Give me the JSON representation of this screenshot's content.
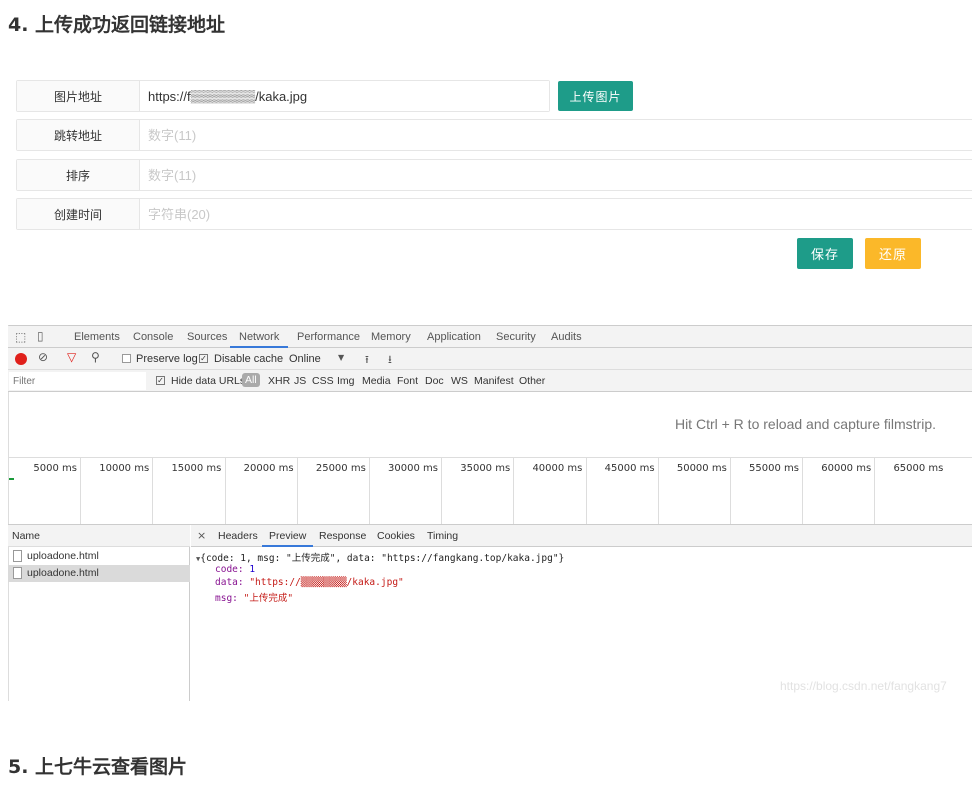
{
  "headings": {
    "h4": "4. 上传成功返回链接地址",
    "h5": "5. 上七牛云查看图片"
  },
  "form": {
    "rows": [
      {
        "label": "图片地址",
        "value": "https://f▒▒▒▒▒▒▒/kaka.jpg",
        "placeholder": ""
      },
      {
        "label": "跳转地址",
        "value": "",
        "placeholder": "数字(11)"
      },
      {
        "label": "排序",
        "value": "",
        "placeholder": "数字(11)"
      },
      {
        "label": "创建时间",
        "value": "",
        "placeholder": "字符串(20)"
      }
    ],
    "upload_label": "上传图片",
    "save_label": "保存",
    "restore_label": "还原",
    "colors": {
      "primary": "#1e9c89",
      "warning": "#fbb829"
    }
  },
  "devtools": {
    "tabs": [
      "Elements",
      "Console",
      "Sources",
      "Network",
      "Performance",
      "Memory",
      "Application",
      "Security",
      "Audits"
    ],
    "active_tab": "Network",
    "toolbar": {
      "preserve_log": "Preserve log",
      "disable_cache": "Disable cache",
      "throttle": "Online"
    },
    "filter": {
      "placeholder": "Filter",
      "hide_data_urls": "Hide data URLs",
      "types": [
        "All",
        "XHR",
        "JS",
        "CSS",
        "Img",
        "Media",
        "Font",
        "Doc",
        "WS",
        "Manifest",
        "Other"
      ]
    },
    "filmstrip_msg": "Hit Ctrl + R to reload and capture filmstrip.",
    "timeline": [
      "5000 ms",
      "10000 ms",
      "15000 ms",
      "20000 ms",
      "25000 ms",
      "30000 ms",
      "35000 ms",
      "40000 ms",
      "45000 ms",
      "50000 ms",
      "55000 ms",
      "60000 ms",
      "65000 ms"
    ],
    "name_header": "Name",
    "requests": [
      "uploadone.html",
      "uploadone.html"
    ],
    "detail_tabs": [
      "Headers",
      "Preview",
      "Response",
      "Cookies",
      "Timing"
    ],
    "active_detail": "Preview",
    "preview": {
      "summary_pre": "{code: 1, msg: ",
      "summary_msg": "\"上传完成\"",
      "summary_mid": ", data: ",
      "summary_data": "\"https://fangkang.top/kaka.jpg\"",
      "summary_end": "}",
      "code_key": "code: ",
      "code_val": "1",
      "data_key": "data: ",
      "data_val": "\"https://▒▒▒▒▒▒▒▒/kaka.jpg\"",
      "msg_key": "msg: ",
      "msg_val": "\"上传完成\""
    }
  },
  "watermark": "https://blog.csdn.net/fangkang7"
}
